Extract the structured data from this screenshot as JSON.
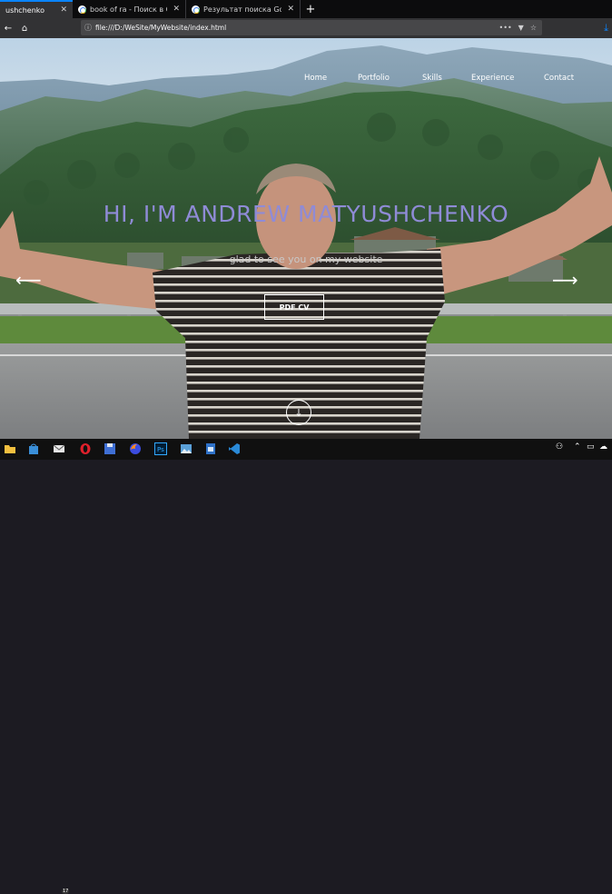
{
  "browser": {
    "tabs": [
      {
        "title": "ushchenko",
        "active": true
      },
      {
        "title": "book of ra - Поиск в Google",
        "active": false
      },
      {
        "title": "Результат поиска Google для",
        "active": false
      }
    ],
    "new_tab_icon": "+",
    "url": "file:///D:/WeSite/MyWebsite/index.html",
    "accent_color": "#0a84ff"
  },
  "site": {
    "nav": [
      "Home",
      "Portfolio",
      "Skills",
      "Experience",
      "Contact"
    ],
    "title": "HI, I'M ANDREW MATYUSHCHENKO",
    "subtitle": "glad to see you on my website",
    "cv_button": "PDF CV",
    "title_color": "#8f8bd6"
  },
  "icons": {
    "arrow_left": "⟵",
    "arrow_right": "⟶",
    "scroll_down": "↓",
    "home": "⌂",
    "back": "←",
    "info": "ⓘ",
    "more": "•••",
    "pocket": "▼",
    "star": "☆",
    "download": "⤓",
    "close": "✕"
  },
  "taskbar": {
    "mail_badge": "17",
    "icons": [
      "folder-icon",
      "store-icon",
      "mail-icon",
      "opera-icon",
      "save-icon",
      "firefox-icon",
      "photoshop-icon",
      "photos-icon",
      "file-icon",
      "vscode-icon"
    ]
  }
}
